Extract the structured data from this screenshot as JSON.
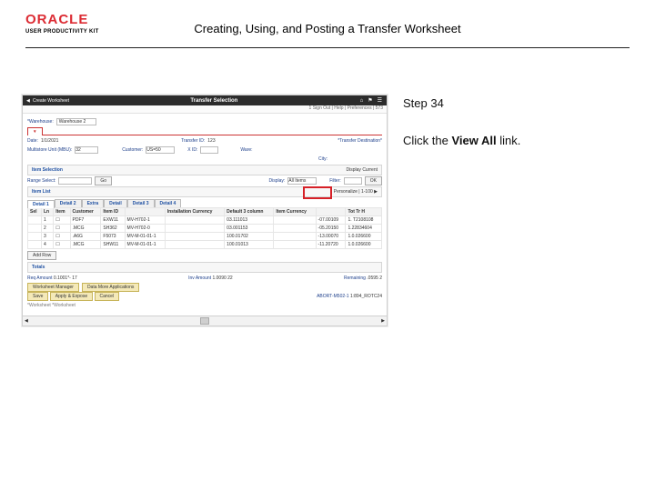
{
  "header": {
    "brand": "ORACLE",
    "subbrand": "USER PRODUCTIVITY KIT",
    "doc_title": "Creating, Using, and Posting a Transfer Worksheet"
  },
  "instructions": {
    "step": "Step 34",
    "text_before": "Click the ",
    "link_text": "View All",
    "text_after": " link."
  },
  "app": {
    "bar": {
      "back": "Create Worksheet",
      "center": "Transfer Selection",
      "icons": {
        "home": "home-icon",
        "flag": "flag-icon",
        "menu": "menu-icon"
      }
    },
    "subbar": "1 Sign Out | Help | Preferences | 573",
    "form": {
      "warehouse_lbl": "*Warehouse:",
      "warehouse_val": "Warehouse 2",
      "date_lbl": "Date:",
      "date_val": "1/1/2021",
      "transfer_lbl": "Transfer ID:",
      "transfer_val": "123",
      "status_lbl": "*Transfer Destination*",
      "multi_lbl": "Multistore Unit (MBU):",
      "multi_val": "32",
      "cust_lbl": "Customer:",
      "cust_val": "US=50",
      "x_lbl": "X ID:",
      "ware_lbl": "Ware:",
      "city_lbl": "City:"
    },
    "section1": "Item Selection",
    "section1_right": "Display Current",
    "range_lbl": "Range Select:",
    "go": "Go",
    "display_lbl": "Display:",
    "display_val": "All Items",
    "filter_lbl": "Filter:",
    "ok": "OK",
    "view_all": "Personalize | 1-100 ▶",
    "section2": "Item List",
    "tabs": [
      "Detail 1",
      "Detail 2",
      "Extra",
      "Detail",
      "Detail 3",
      "Detail 4"
    ],
    "cols": [
      "Sel",
      "Ln",
      "Item",
      "Customer",
      "Item ID",
      "",
      "Installation Currency",
      "Default 3 column",
      "Item Currency",
      "",
      "Tot  Tr  H"
    ],
    "rows": [
      [
        "",
        "1",
        "☐",
        "PDF7",
        "EXW11",
        "MV-H702-1",
        "",
        "03.111013",
        "",
        "-07.00109",
        "1. T2108108"
      ],
      [
        "",
        "2",
        "☐",
        ".MCG",
        "SH362",
        "MV-H702-0",
        "",
        "03.001153",
        "",
        "-05.20150",
        "1.22834604"
      ],
      [
        "",
        "3",
        "☐",
        ".A6G",
        "F5073",
        "MV-M-01-01-1",
        "",
        "100.01702",
        "",
        "-13.00070",
        "1.0.026600"
      ],
      [
        "",
        "4",
        "☐",
        ".MCG",
        "SHW11",
        "MV-M-01-01-1",
        "",
        "100.01013",
        "",
        "-11.20720",
        "1.0.026600"
      ]
    ],
    "add_row": "Add Row",
    "section3": "Totals",
    "totals": {
      "req_lbl": "Req Amount",
      "req_val": "0.1001*-",
      "req_q": "17",
      "ins_lbl": "Inv Amount",
      "ins_val": "1.0090",
      "ins_q": "22",
      "rem_lbl": "Remaining",
      "rem_val": ".0595",
      "rem_q": "2"
    },
    "btns": [
      "Worksheet Manager",
      "Data More Applications"
    ],
    "footer_btns": [
      "Save",
      "Apply & Expose",
      "Cancel"
    ],
    "footer_right_lbl": "ABORT-M502-1",
    "footer_right_val": "1:894_ROTC24",
    "footer_links": "*Worksheet   *Worksheet"
  }
}
